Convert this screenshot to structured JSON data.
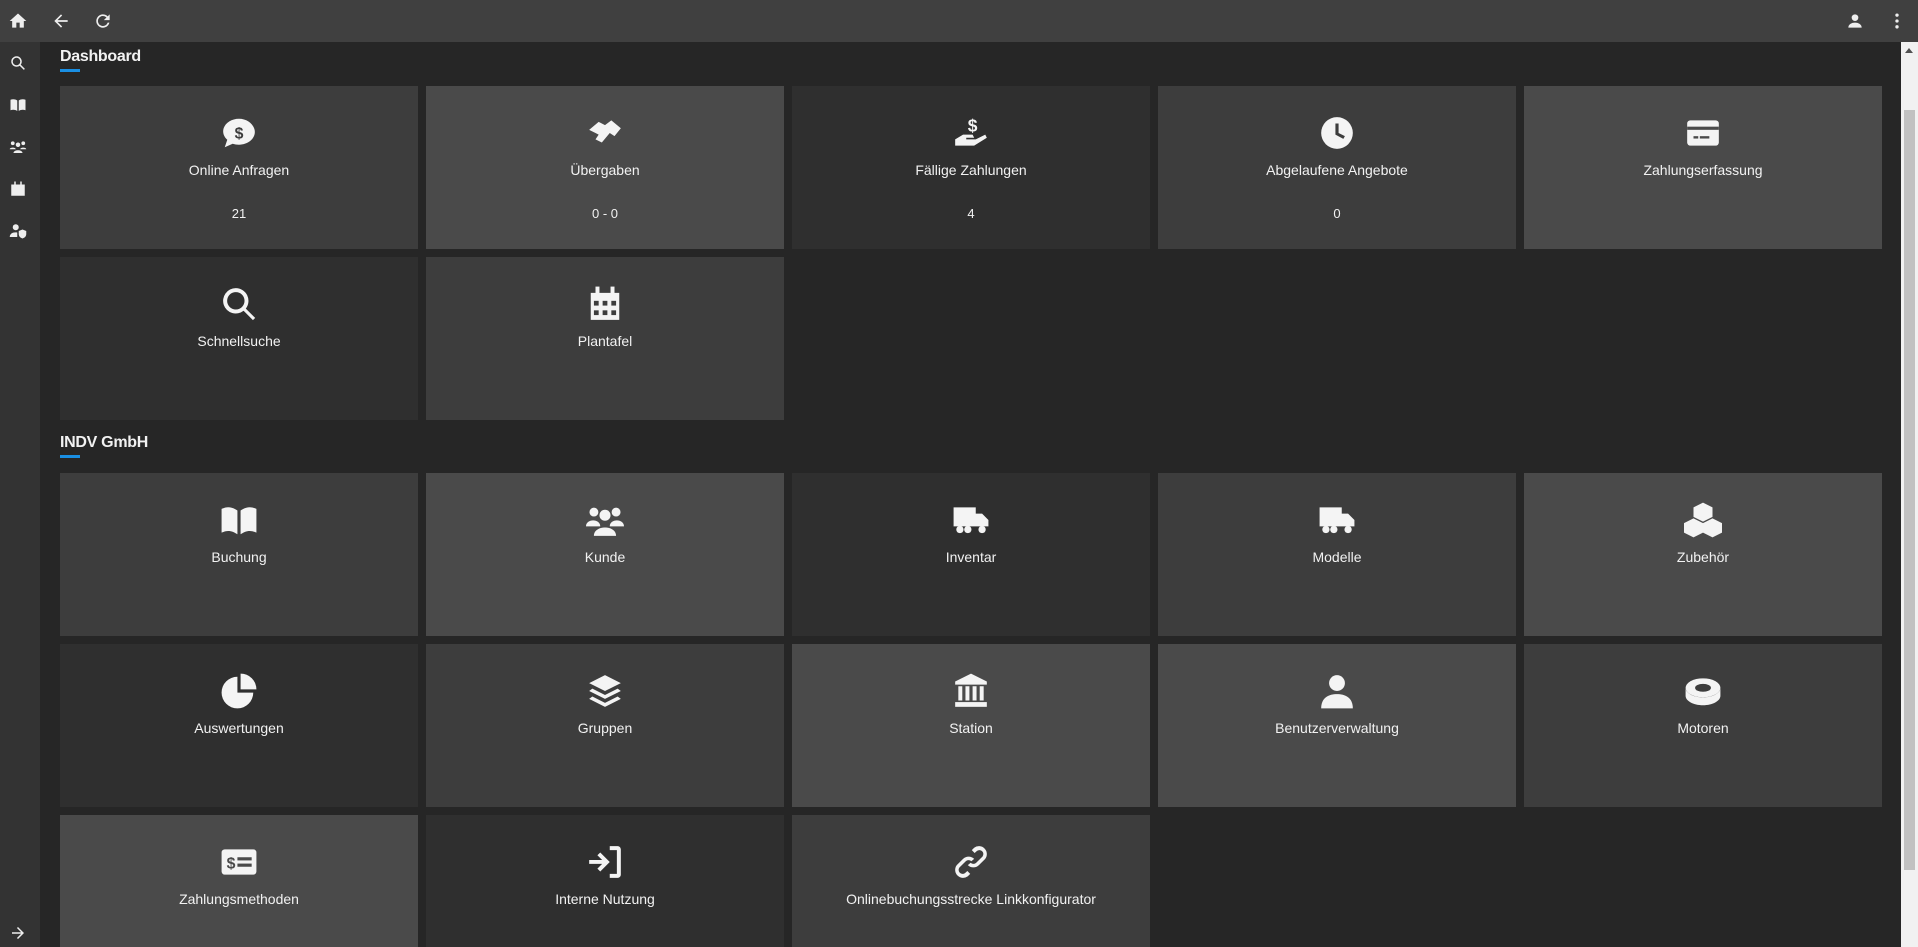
{
  "topbar": {
    "icons": [
      "home-icon",
      "back-arrow-icon",
      "reload-icon",
      "user-icon",
      "more-vertical-icon"
    ]
  },
  "sidebar": {
    "icons": [
      "search-icon",
      "book-icon",
      "users-icon",
      "calendar-icon",
      "user-shield-icon",
      "expand-arrow-icon"
    ]
  },
  "sections": [
    {
      "title": "Dashboard",
      "tiles": [
        {
          "label": "Online Anfragen",
          "value": "21",
          "icon": "comment-dollar",
          "shade": "#3d3d3d"
        },
        {
          "label": "Übergaben",
          "value": "0 - 0",
          "icon": "handshake",
          "shade": "#4a4a4a"
        },
        {
          "label": "Fällige Zahlungen",
          "value": "4",
          "icon": "hand-dollar",
          "shade": "#2f2f2f"
        },
        {
          "label": "Abgelaufene Angebote",
          "value": "0",
          "icon": "clock",
          "shade": "#3d3d3d"
        },
        {
          "label": "Zahlungserfassung",
          "icon": "credit-card",
          "shade": "#4a4a4a"
        },
        {
          "label": "Schnellsuche",
          "icon": "search",
          "shade": "#2f2f2f"
        },
        {
          "label": "Plantafel",
          "icon": "calendar",
          "shade": "#3d3d3d"
        }
      ]
    },
    {
      "title": "INDV GmbH",
      "tiles": [
        {
          "label": "Buchung",
          "icon": "book",
          "shade": "#3d3d3d"
        },
        {
          "label": "Kunde",
          "icon": "users",
          "shade": "#4a4a4a"
        },
        {
          "label": "Inventar",
          "icon": "truck",
          "shade": "#2f2f2f"
        },
        {
          "label": "Modelle",
          "icon": "truck",
          "shade": "#3d3d3d"
        },
        {
          "label": "Zubehör",
          "icon": "cubes",
          "shade": "#4a4a4a"
        },
        {
          "label": "Auswertungen",
          "icon": "pie-chart",
          "shade": "#2f2f2f"
        },
        {
          "label": "Gruppen",
          "icon": "layers",
          "shade": "#3d3d3d"
        },
        {
          "label": "Station",
          "icon": "bank",
          "shade": "#4a4a4a"
        },
        {
          "label": "Benutzerverwaltung",
          "icon": "user",
          "shade": "#4a4a4a"
        },
        {
          "label": "Motoren",
          "icon": "tire",
          "shade": "#3d3d3d"
        },
        {
          "label": "Zahlungsmethoden",
          "icon": "money-list",
          "shade": "#4a4a4a"
        },
        {
          "label": "Interne Nutzung",
          "icon": "sign-in",
          "shade": "#2f2f2f"
        },
        {
          "label": "Onlinebuchungsstrecke Linkkonfigurator",
          "icon": "link",
          "shade": "#3d3d3d"
        }
      ]
    }
  ]
}
